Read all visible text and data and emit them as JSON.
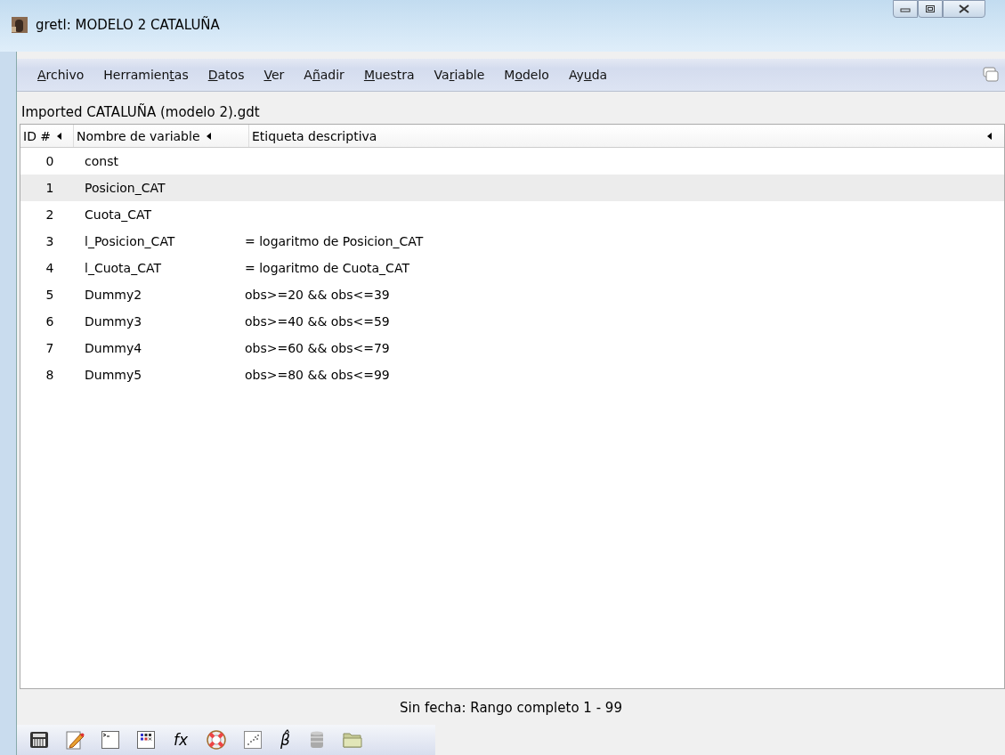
{
  "window": {
    "title": "gretl: MODELO 2 CATALUÑA"
  },
  "menu": [
    {
      "key": "A",
      "after": "rchivo"
    },
    {
      "before": "Herramien",
      "key": "t",
      "after": "as"
    },
    {
      "key": "D",
      "after": "atos"
    },
    {
      "key": "V",
      "after": "er"
    },
    {
      "before": "A",
      "key": "ñ",
      "after": "adir"
    },
    {
      "key": "M",
      "after": "uestra"
    },
    {
      "before": "Va",
      "key": "r",
      "after": "iable"
    },
    {
      "before": "M",
      "key": "o",
      "after": "delo"
    },
    {
      "before": "Ay",
      "key": "u",
      "after": "da"
    }
  ],
  "dataset_name": "Imported CATALUÑA (modelo 2).gdt",
  "table": {
    "columns": [
      "ID #",
      "Nombre de variable",
      "Etiqueta descriptiva"
    ],
    "rows": [
      {
        "id": "0",
        "name": "const",
        "selected": false
      },
      {
        "id": "1",
        "name": "Posicion_CAT",
        "selected": true
      },
      {
        "id": "2",
        "name": "Cuota_CAT",
        "selected": false
      },
      {
        "id": "3",
        "name": "l_Posicion_CAT",
        "label": "= logaritmo de Posicion_CAT",
        "selected": false
      },
      {
        "id": "4",
        "name": "l_Cuota_CAT",
        "label": "= logaritmo de Cuota_CAT",
        "selected": false
      },
      {
        "id": "5",
        "name": "Dummy2",
        "label": "obs>=20 && obs<=39",
        "selected": false
      },
      {
        "id": "6",
        "name": "Dummy3",
        "label": "obs>=40 && obs<=59",
        "selected": false
      },
      {
        "id": "7",
        "name": "Dummy4",
        "label": "obs>=60 && obs<=79",
        "selected": false
      },
      {
        "id": "8",
        "name": "Dummy5",
        "label": "obs>=80 && obs<=99",
        "selected": false
      }
    ]
  },
  "status_bar": "Sin fecha: Rango completo 1 - 99",
  "toolbar": [
    {
      "kind": "calculator"
    },
    {
      "kind": "script"
    },
    {
      "kind": "console"
    },
    {
      "kind": "session"
    },
    {
      "kind": "text",
      "text": "fx"
    },
    {
      "kind": "help"
    },
    {
      "kind": "scatter"
    },
    {
      "kind": "text",
      "text": "β̂"
    },
    {
      "kind": "database"
    },
    {
      "kind": "folder"
    }
  ]
}
